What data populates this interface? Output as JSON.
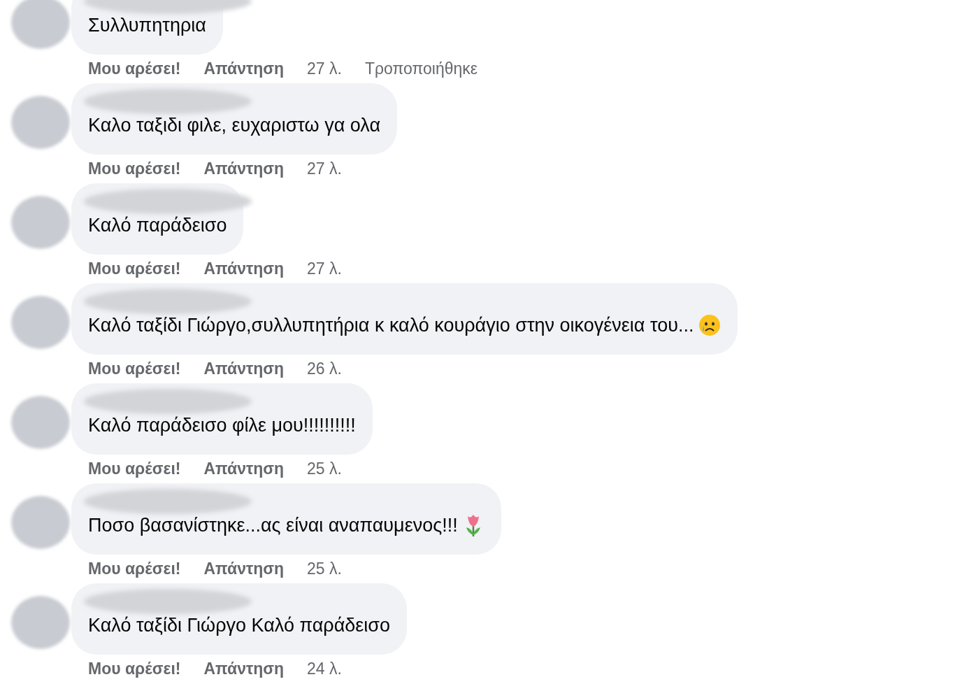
{
  "comments": [
    {
      "kind": "plain",
      "text": "Συλλυπητηρια",
      "like": "Μου αρέσει!",
      "reply": "Απάντηση",
      "time": "27 λ.",
      "edited_label": "Τροποποιήθηκε"
    },
    {
      "kind": "plain",
      "text": "Καλο ταξιδι φιλε, ευχαριστω γα ολα",
      "like": "Μου αρέσει!",
      "reply": "Απάντηση",
      "time": "27 λ."
    },
    {
      "kind": "plain",
      "text": "Καλό παράδεισο",
      "like": "Μου αρέσει!",
      "reply": "Απάντηση",
      "time": "27 λ."
    },
    {
      "kind": "sad_emoji",
      "text": "Καλό ταξίδι Γιώργο,συλλυπητήρια κ καλό κουράγιο στην οικογένεια του...",
      "like": "Μου αρέσει!",
      "reply": "Απάντηση",
      "time": "26 λ."
    },
    {
      "kind": "plain",
      "text": "Καλό παράδεισο φίλε μου!!!!!!!!!!",
      "like": "Μου αρέσει!",
      "reply": "Απάντηση",
      "time": "25 λ."
    },
    {
      "kind": "flower_emoji",
      "text": "Ποσο βασανίστηκε...ας είναι αναπαυμενος!!!",
      "like": "Μου αρέσει!",
      "reply": "Απάντηση",
      "time": "25 λ."
    },
    {
      "kind": "plain",
      "text": "Καλό ταξίδι Γιώργο Καλό παράδεισο",
      "like": "Μου αρέσει!",
      "reply": "Απάντηση",
      "time": "24 λ."
    }
  ]
}
